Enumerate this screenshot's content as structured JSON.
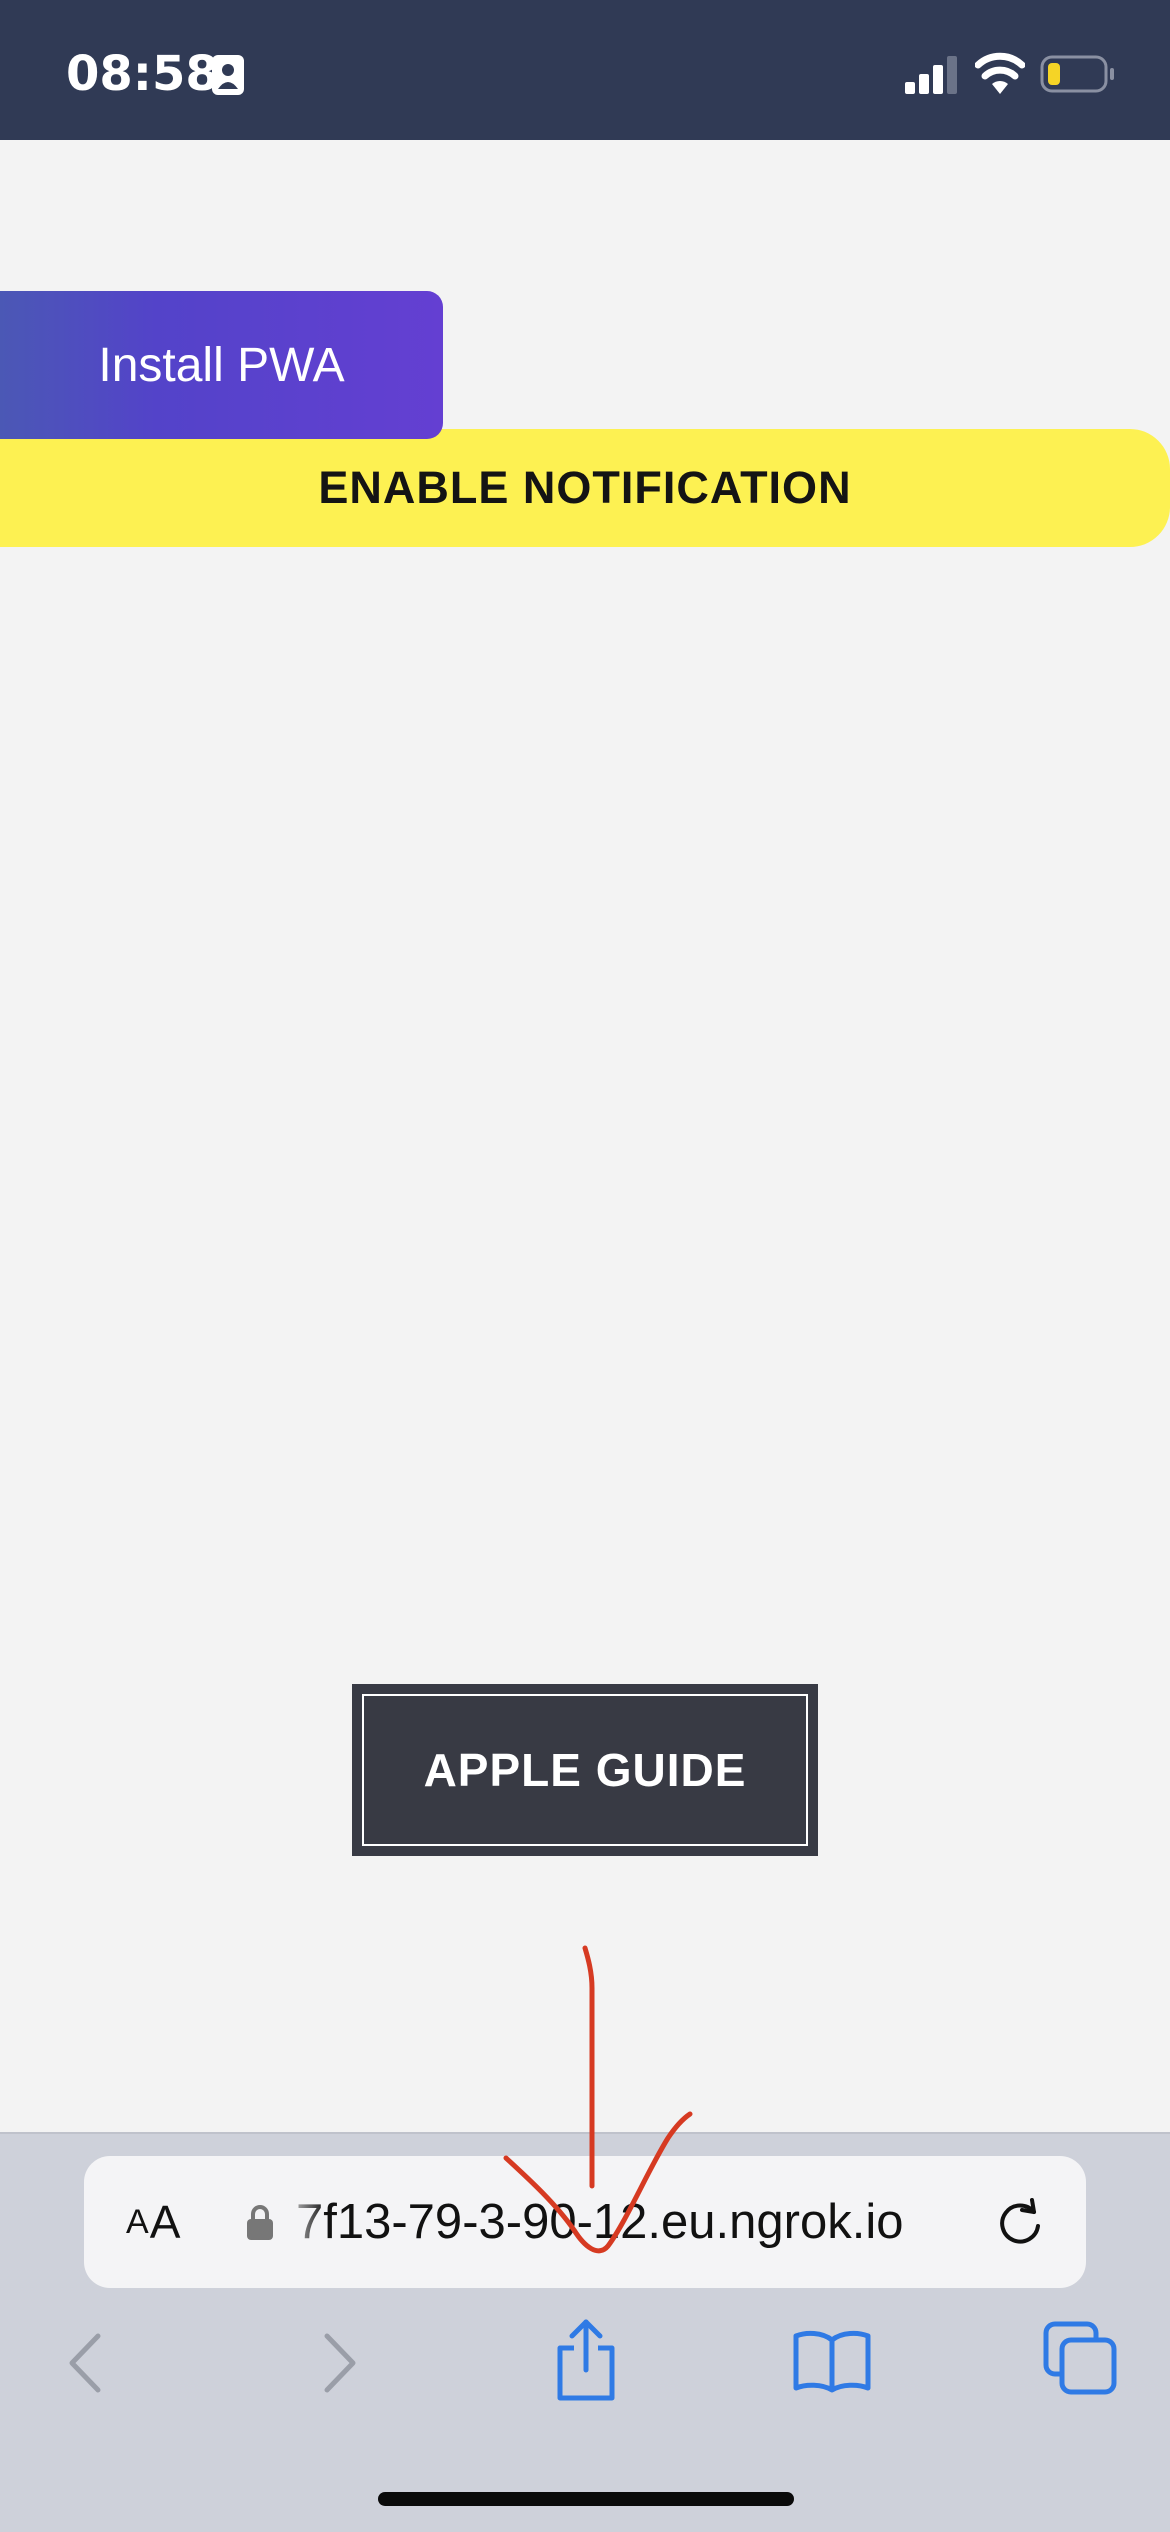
{
  "status_bar": {
    "time": "08:58",
    "background_color": "#303a55",
    "icons": [
      "person-badge-icon",
      "cellular-signal-icon",
      "wifi-icon",
      "battery-icon"
    ]
  },
  "page": {
    "install_button_label": "Install PWA",
    "notification_label": "ENABLE NOTIFICATION",
    "notification_color": "#fdf152",
    "apple_guide_label": "APPLE GUIDE"
  },
  "browser": {
    "text_size_small": "A",
    "text_size_large": "A",
    "url": "7f13-79-3-90-12.eu.ngrok.io",
    "icons": [
      "lock-icon",
      "reload-icon",
      "back-icon",
      "forward-icon",
      "share-icon",
      "bookmarks-icon",
      "tabs-icon"
    ],
    "accent_color": "#2f7ae5"
  },
  "annotation": {
    "type": "hand-drawn arrow pointing down to share button",
    "color": "#d63a22"
  }
}
